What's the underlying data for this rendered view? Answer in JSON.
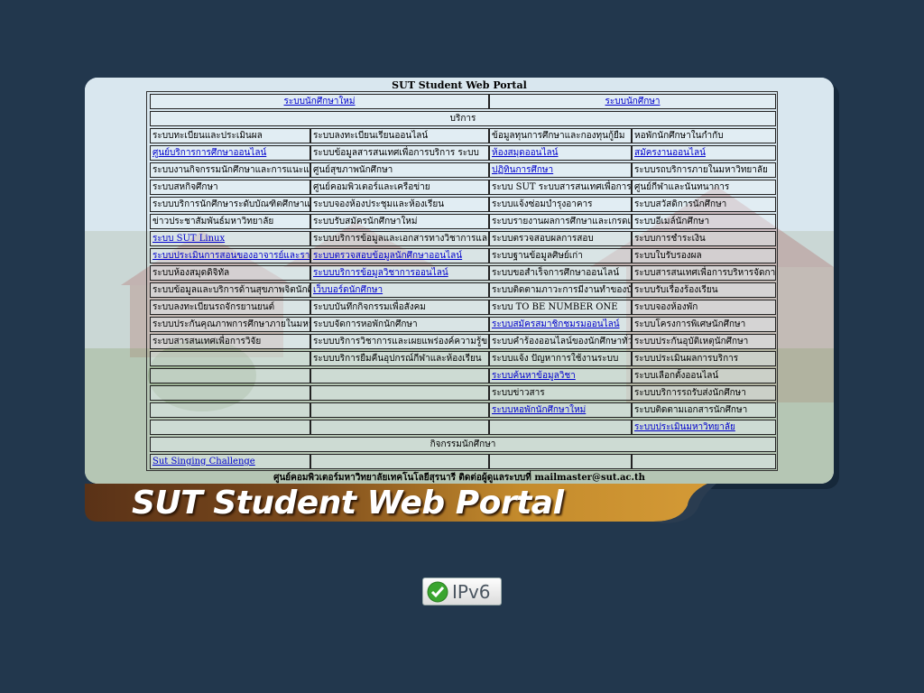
{
  "portal": {
    "title": "SUT Student Web Portal",
    "header_links": [
      "ระบบนักศึกษาใหม่",
      "ระบบนักศึกษา"
    ],
    "section_title": "บริการ",
    "rows": [
      [
        {
          "t": "ระบบทะเบียนและประเมินผล",
          "link": false
        },
        {
          "t": "ระบบลงทะเบียนเรียนออนไลน์",
          "link": false
        },
        {
          "t": "ข้อมูลทุนการศึกษาและกองทุนกู้ยืม",
          "link": false
        },
        {
          "t": "หอพักนักศึกษาในกำกับ",
          "link": false
        }
      ],
      [
        {
          "t": "ศูนย์บริการการศึกษาออนไลน์",
          "link": true
        },
        {
          "t": "ระบบข้อมูลสารสนเทศเพื่อการบริการ ระบบ",
          "link": false
        },
        {
          "t": "ห้องสมุดออนไลน์",
          "link": true
        },
        {
          "t": "สมัครงานออนไลน์",
          "link": true
        }
      ],
      [
        {
          "t": "ระบบงานกิจกรรมนักศึกษาและการแนะแนวอาชีพ",
          "link": false
        },
        {
          "t": "ศูนย์สุขภาพนักศึกษา",
          "link": false
        },
        {
          "t": "ปฏิทินการศึกษา",
          "link": true
        },
        {
          "t": "ระบบรถบริการภายในมหาวิทยาลัย",
          "link": false
        }
      ],
      [
        {
          "t": "ระบบสหกิจศึกษา",
          "link": false
        },
        {
          "t": "ศูนย์คอมพิวเตอร์และเครือข่าย",
          "link": false
        },
        {
          "t": "ระบบ SUT ระบบสารสนเทศเพื่อการจัดการเรียนรู้",
          "link": false
        },
        {
          "t": "ศูนย์กีฬาและนันทนาการ",
          "link": false
        }
      ],
      [
        {
          "t": "ระบบบริการนักศึกษาระดับบัณฑิตศึกษาและนักศึกษาต่างชาติ",
          "link": false
        },
        {
          "t": "ระบบจองห้องประชุมและห้องเรียน",
          "link": false
        },
        {
          "t": "ระบบแจ้งซ่อมบำรุงอาคาร",
          "link": false
        },
        {
          "t": "ระบบสวัสดิการนักศึกษา",
          "link": false
        }
      ],
      [
        {
          "t": "ข่าวประชาสัมพันธ์มหาวิทยาลัย",
          "link": false
        },
        {
          "t": "ระบบรับสมัครนักศึกษาใหม่",
          "link": false
        },
        {
          "t": "ระบบรายงานผลการศึกษาและเกรดเฉลี่ย",
          "link": false
        },
        {
          "t": "ระบบอีเมล์นักศึกษา",
          "link": false
        }
      ],
      [
        {
          "t": "ระบบ SUT Linux",
          "link": true
        },
        {
          "t": "ระบบบริการข้อมูลและเอกสารทางวิชาการและงานวิจัยของมหาวิทยาลัยเทคโนโลยีสุรนารีเพื่อนักศึกษา",
          "link": false
        },
        {
          "t": "ระบบตรวจสอบผลการสอบ",
          "link": false
        },
        {
          "t": "ระบบการชำระเงิน",
          "link": false
        }
      ],
      [
        {
          "t": "ระบบประเมินการสอนของอาจารย์และรายวิชาทางเว็บไซต์ ระบบ",
          "link": true
        },
        {
          "t": "ระบบตรวจสอบข้อมูลนักศึกษาออนไลน์",
          "link": true
        },
        {
          "t": "ระบบฐานข้อมูลศิษย์เก่า",
          "link": false
        },
        {
          "t": "ระบบใบรับรองผล",
          "link": false
        }
      ],
      [
        {
          "t": "ระบบห้องสมุดดิจิทัล",
          "link": false
        },
        {
          "t": "ระบบบริการข้อมูลวิชาการออนไลน์",
          "link": true
        },
        {
          "t": "ระบบขอสำเร็จการศึกษาออนไลน์",
          "link": false
        },
        {
          "t": "ระบบสารสนเทศเพื่อการบริหารจัดการหลักสูตรและการเรียนการสอนออนไลน์",
          "link": false
        }
      ],
      [
        {
          "t": "ระบบข้อมูลและบริการด้านสุขภาพจิตนักศึกษาและบุคลากรมหาวิทยาลัย",
          "link": false
        },
        {
          "t": "เว็บบอร์ดนักศึกษา",
          "link": true
        },
        {
          "t": "ระบบติดตามภาวะการมีงานทำของบัณฑิต",
          "link": false
        },
        {
          "t": "ระบบรับเรื่องร้องเรียน",
          "link": false
        }
      ],
      [
        {
          "t": "ระบบลงทะเบียนรถจักรยานยนต์",
          "link": false
        },
        {
          "t": "ระบบบันทึกกิจกรรมเพื่อสังคม",
          "link": false
        },
        {
          "t": "ระบบ TO BE NUMBER ONE",
          "link": false
        },
        {
          "t": "ระบบจองห้องพัก",
          "link": false
        }
      ],
      [
        {
          "t": "ระบบประกันคุณภาพการศึกษาภายในมหาวิทยาลัยเทคโนโลยีสุรนารี",
          "link": false
        },
        {
          "t": "ระบบจัดการหอพักนักศึกษา",
          "link": false
        },
        {
          "t": "ระบบสมัครสมาชิกชมรมออนไลน์",
          "link": true
        },
        {
          "t": "ระบบโครงการพิเศษนักศึกษา",
          "link": false
        }
      ],
      [
        {
          "t": "ระบบสารสนเทศเพื่อการวิจัย",
          "link": false
        },
        {
          "t": "ระบบบริการวิชาการและเผยแพร่องค์ความรู้ของมหาวิทยาลัยเพื่อชุมชน",
          "link": false
        },
        {
          "t": "ระบบคำร้องออนไลน์ของนักศึกษาทั่วไป",
          "link": false
        },
        {
          "t": "ระบบประกันอุบัติเหตุนักศึกษา",
          "link": false
        }
      ],
      [
        {
          "t": "",
          "link": false
        },
        {
          "t": "ระบบบริการยืมคืนอุปกรณ์กีฬาและห้องเรียน",
          "link": false
        },
        {
          "t": "ระบบแจ้ง ปัญหาการใช้งานระบบ",
          "link": false
        },
        {
          "t": "ระบบประเมินผลการบริการ",
          "link": false
        }
      ],
      [
        {
          "t": "",
          "link": false
        },
        {
          "t": "",
          "link": false
        },
        {
          "t": "ระบบค้นหาข้อมูลวิชา",
          "link": true
        },
        {
          "t": "ระบบเลือกตั้งออนไลน์",
          "link": false
        }
      ],
      [
        {
          "t": "",
          "link": false
        },
        {
          "t": "",
          "link": false
        },
        {
          "t": "ระบบข่าวสาร",
          "link": false
        },
        {
          "t": "ระบบบริการรถรับส่งนักศึกษา",
          "link": false
        }
      ],
      [
        {
          "t": "",
          "link": false
        },
        {
          "t": "",
          "link": false
        },
        {
          "t": "ระบบหอพักนักศึกษาใหม่",
          "link": true
        },
        {
          "t": "ระบบติดตามเอกสารนักศึกษา",
          "link": false
        }
      ],
      [
        {
          "t": "",
          "link": false
        },
        {
          "t": "",
          "link": false
        },
        {
          "t": "",
          "link": false
        },
        {
          "t": "ระบบประเมินมหาวิทยาลัย",
          "link": true
        }
      ]
    ],
    "section2_title": "กิจกรรมนักศึกษา",
    "activity_row": [
      {
        "t": "Sut Singing Challenge",
        "link": true
      },
      {
        "t": "",
        "link": false
      },
      {
        "t": "",
        "link": false
      },
      {
        "t": "",
        "link": false
      }
    ],
    "footer": "ศูนย์คอมพิวเตอร์มหาวิทยาลัยเทคโนโลยีสุรนารี ติดต่อผู้ดูแลระบบที่ mailmaster@sut.ac.th"
  },
  "banner": {
    "title": "SUT Student Web Portal"
  },
  "badge": {
    "label": "IPv6",
    "icon": "check-icon"
  }
}
